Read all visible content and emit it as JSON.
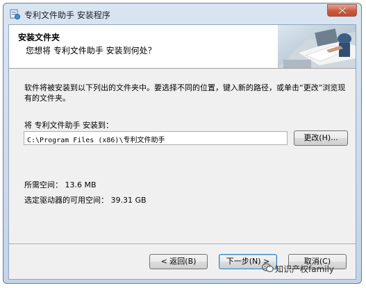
{
  "window": {
    "title": "专利文件助手 安装程序"
  },
  "header": {
    "title": "安装文件夹",
    "subtitle": "您想将 专利文件助手 安装到何处？"
  },
  "body": {
    "description": "软件将被安装到以下列出的文件夹中。要选择不同的位置，键入新的路径，或单击“更改”浏览现有的文件夹。",
    "install_label": "将 专利文件助手 安装到：",
    "install_path": "C:\\Program Files (x86)\\专利文件助手",
    "change_button": "更改(H)...",
    "space_required": "所需空间： 13.6 MB",
    "space_available": "选定驱动器的可用空间： 39.31 GB"
  },
  "footer": {
    "back_button": "< 返回(B)",
    "next_button": "下一步(N) >",
    "cancel_button": "取消(C)"
  },
  "watermark": {
    "text": "知识产权family"
  },
  "colors": {
    "window_frame": "#c3d4e8",
    "close_button": "#c85a3e",
    "dialog_bg": "#f0f0f0",
    "default_button_border": "#3c7fb1"
  },
  "icons": {
    "app": "installer-icon",
    "close": "close-icon",
    "watermark": "wechat-icon"
  }
}
